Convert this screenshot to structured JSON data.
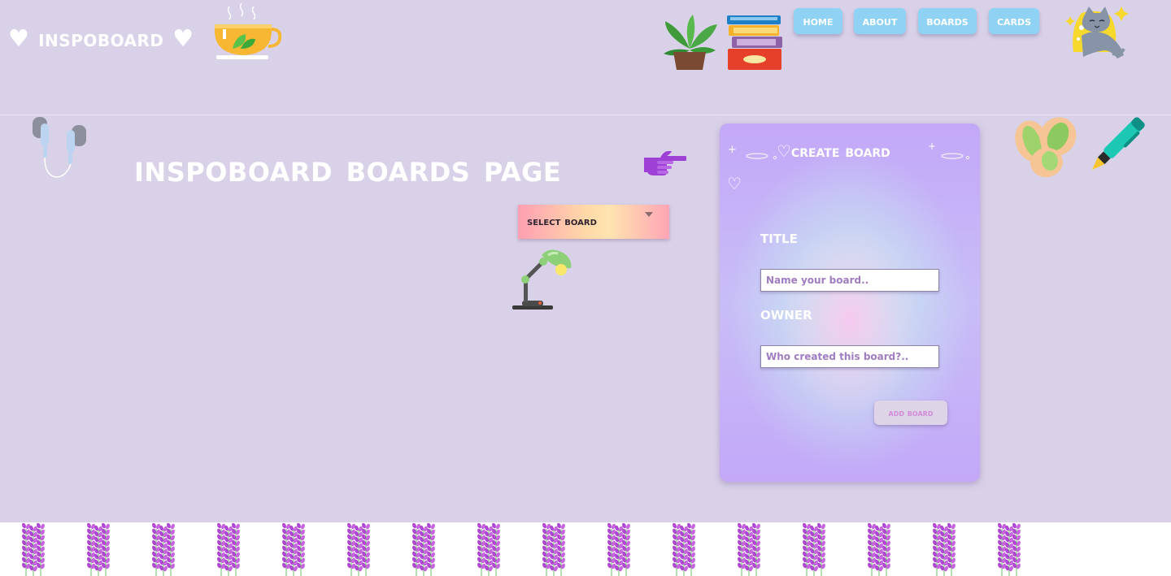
{
  "header": {
    "logo": "♥ Inspoboard ♥",
    "nav": [
      {
        "label": "Home"
      },
      {
        "label": "About"
      },
      {
        "label": "Boards"
      },
      {
        "label": "Cards"
      }
    ]
  },
  "main": {
    "title": "Inspoboard Boards Page",
    "select_board": {
      "value": "Select Board"
    }
  },
  "form": {
    "heading": "♡Create Board",
    "heart": "♡",
    "title_label": "Title",
    "title_placeholder": "Name your board..",
    "owner_label": "owner",
    "owner_placeholder": "Who created this board?..",
    "submit_label": "Add Board"
  },
  "colors": {
    "background": "#d9d1e8",
    "nav_button": "#8fd2f3",
    "card_gradient": "#c3a8f8",
    "accent_pink": "#d18bd8"
  },
  "icons": [
    "teacup-icon",
    "plant-icon",
    "books-icon",
    "cat-icon",
    "headphones-icon",
    "pointing-hand-icon",
    "desk-lamp-icon",
    "pistachio-icon",
    "pen-icon",
    "lavender-icon"
  ]
}
